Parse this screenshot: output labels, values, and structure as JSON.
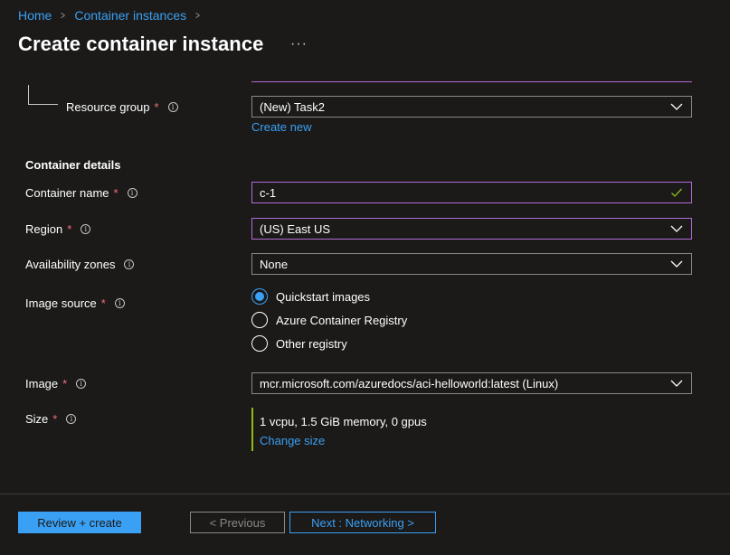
{
  "breadcrumb": {
    "home": "Home",
    "container_instances": "Container instances",
    "separator": ">"
  },
  "page": {
    "title": "Create container instance",
    "more": "···"
  },
  "resource_group": {
    "label": "Resource group",
    "value": "(New) Task2",
    "create_new": "Create new"
  },
  "container_details": {
    "title": "Container details",
    "container_name": {
      "label": "Container name",
      "value": "c-1"
    },
    "region": {
      "label": "Region",
      "value": "(US) East US"
    },
    "availability_zones": {
      "label": "Availability zones",
      "value": "None"
    },
    "image_source": {
      "label": "Image source",
      "options": [
        "Quickstart images",
        "Azure Container Registry",
        "Other registry"
      ],
      "selected": "Quickstart images"
    },
    "image": {
      "label": "Image",
      "value": "mcr.microsoft.com/azuredocs/aci-helloworld:latest (Linux)"
    },
    "size": {
      "label": "Size",
      "value": "1 vcpu, 1.5 GiB memory, 0 gpus",
      "change": "Change size"
    }
  },
  "required_mark": "*",
  "info_glyph": "i",
  "footer": {
    "review_create": "Review + create",
    "previous": "< Previous",
    "next": "Next : Networking >"
  },
  "colors": {
    "accent": "#3aa0f3",
    "focus": "#b36ad6",
    "required": "#f1707b",
    "valid": "#8cbd18"
  }
}
